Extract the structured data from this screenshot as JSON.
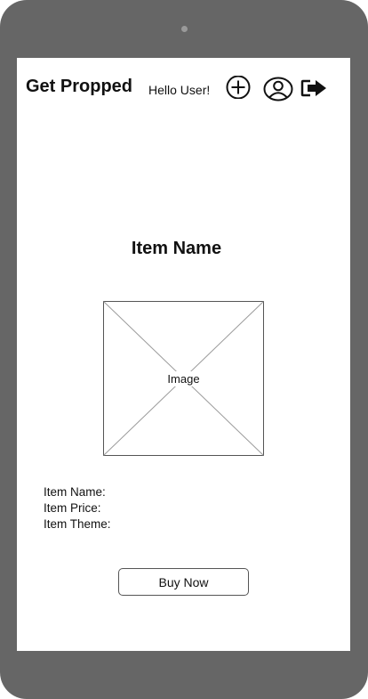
{
  "header": {
    "app_title": "Get Propped",
    "greeting": "Hello User!",
    "icons": [
      "plus-circle-icon",
      "user-circle-icon",
      "logout-arrow-icon"
    ]
  },
  "item": {
    "title": "Item Name",
    "image_label": "Image",
    "details": {
      "name_label": "Item Name:",
      "name_value": "",
      "price_label": "Item Price:",
      "price_value": "",
      "theme_label": "Item Theme:",
      "theme_value": ""
    }
  },
  "actions": {
    "buy_label": "Buy Now"
  },
  "colors": {
    "device_frame": "#666666",
    "screen_background": "#ffffff",
    "text": "#111111",
    "placeholder_stroke": "#9a9a9a"
  }
}
